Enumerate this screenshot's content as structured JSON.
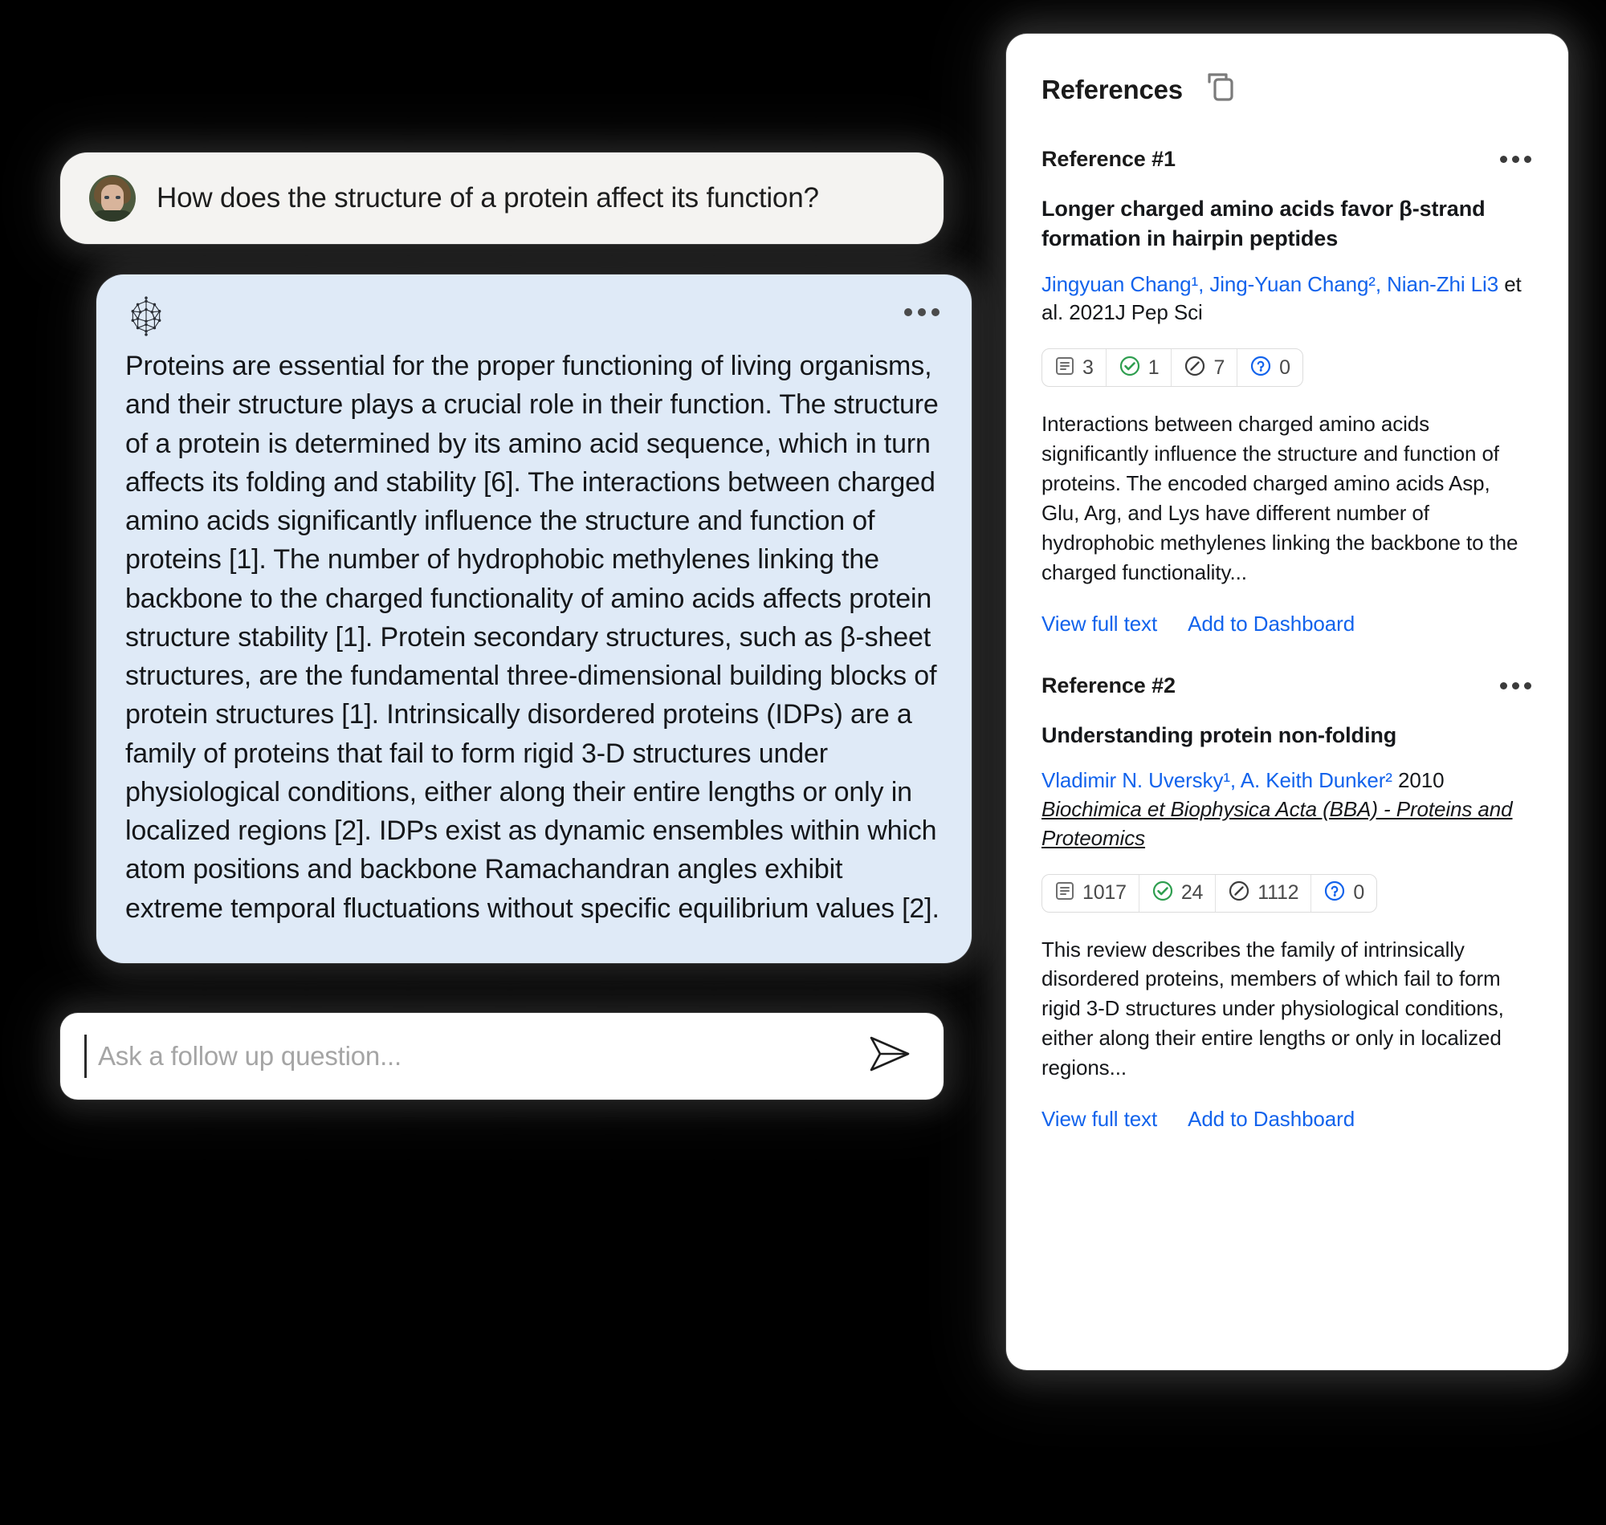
{
  "theme": {
    "page_bg": "#000000",
    "user_bubble_bg": "#f4f3f1",
    "assistant_bubble_bg": "#dfeaf7",
    "panel_bg": "#ffffff",
    "link_blue": "#1263ec",
    "check_green": "#2e9e4f",
    "question_blue": "#1263ec",
    "text_dark": "#15171a"
  },
  "chat": {
    "user_message": {
      "avatar": "user-avatar-photo",
      "text": "How does the structure of a protein affect its function?"
    },
    "assistant_message": {
      "logo": "brain-network-logo",
      "menu": "more-options-icon",
      "text": "Proteins are essential for the proper functioning of living organisms, and their structure plays a crucial role in their function. The structure of a protein is determined by its amino acid sequence, which in turn affects its folding and stability [6]. The interactions between charged amino acids significantly influence the structure and function of proteins [1]. The number of hydrophobic methylenes linking the backbone to the charged functionality of amino acids affects protein structure stability [1]. Protein secondary structures, such as β-sheet structures, are the fundamental three-dimensional building blocks of protein structures [1]. Intrinsically disordered proteins (IDPs) are a family of proteins that fail to form rigid 3-D structures under physiological conditions, either along their entire lengths or only in localized regions [2]. IDPs exist as dynamic ensembles within which atom positions and backbone Ramachandran angles exhibit extreme temporal fluctuations without specific equilibrium values [2]."
    },
    "composer": {
      "value": "",
      "placeholder": "Ask a follow up question...",
      "send_icon": "send-paper-plane-icon"
    }
  },
  "references_panel": {
    "title": "References",
    "copy_icon": "copy-icon",
    "items": [
      {
        "label": "Reference #1",
        "menu_icon": "more-options-icon",
        "title": "Longer charged amino acids favor β-strand formation in hairpin peptides",
        "authors": "Jingyuan Chang¹, Jing-Yuan Chang², Nian-Zhi Li3",
        "trailing_meta": " et al. 2021J Pep Sci",
        "journal": "",
        "metrics": [
          {
            "icon": "document-icon",
            "value": "3"
          },
          {
            "icon": "check-circle-icon",
            "value": "1"
          },
          {
            "icon": "slash-circle-icon",
            "value": "7"
          },
          {
            "icon": "question-circle-icon",
            "value": "0"
          }
        ],
        "abstract": "Interactions between charged amino acids significantly influence the structure and function of proteins. The encoded charged amino acids Asp, Glu, Arg, and Lys have different number of hydrophobic methylenes linking the backbone to the charged functionality...",
        "actions": [
          "View full text",
          "Add to Dashboard"
        ]
      },
      {
        "label": "Reference #2",
        "menu_icon": "more-options-icon",
        "title": "Understanding protein non-folding",
        "authors": "Vladimir N. Uversky¹, A. Keith Dunker²",
        "trailing_meta": " 2010 ",
        "journal": "Biochimica et Biophysica Acta (BBA) - Proteins and Proteomics",
        "metrics": [
          {
            "icon": "document-icon",
            "value": "1017"
          },
          {
            "icon": "check-circle-icon",
            "value": "24"
          },
          {
            "icon": "slash-circle-icon",
            "value": "1112"
          },
          {
            "icon": "question-circle-icon",
            "value": "0"
          }
        ],
        "abstract": "This review describes the family of intrinsically disordered proteins, members of which fail to form rigid 3-D structures under physiological conditions, either along their entire lengths or only in localized regions...",
        "actions": [
          "View full text",
          "Add to Dashboard"
        ]
      }
    ]
  }
}
